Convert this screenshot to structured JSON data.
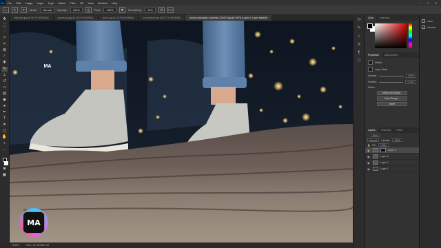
{
  "app": {
    "logo_text": "Ps"
  },
  "menu": [
    "File",
    "Edit",
    "Image",
    "Layer",
    "Type",
    "Select",
    "Filter",
    "3D",
    "View",
    "Window",
    "Help"
  ],
  "window_controls": [
    "–",
    "□",
    "✕"
  ],
  "options_bar": {
    "mode_label": "Mode:",
    "mode_value": "Normal",
    "opacity_label": "Opacity:",
    "opacity_value": "100%",
    "flow_label": "Flow:",
    "flow_value": "100%",
    "smoothing_label": "Smoothing:",
    "smoothing_value": "10%"
  },
  "tabs": [
    {
      "label": "night-sky.jpg @ 16.7% (RGB/8#)"
    },
    {
      "label": "pexels-bg.jpg @ 16.7% (RGB/8#)"
    },
    {
      "label": "stone.jpg @ 16.7% (RGB/8#)"
    },
    {
      "label": "rock-texture.jpg @ 16.7% (RGB/8#)"
    },
    {
      "label": "pexels-sebastian-voortman-214574.jpg @ 200% (Layer 4, Layer Mask/8)",
      "active": true
    }
  ],
  "status": {
    "zoom": "200%",
    "doc": "Doc: 12.1M/36.4M"
  },
  "panels": {
    "color_tabs": [
      "Color",
      "Swatches"
    ],
    "props_tabs": [
      "Properties",
      "Adjustments"
    ],
    "masks_label": "Masks",
    "layer_mask_label": "Layer Mask",
    "density_label": "Density:",
    "density_value": "100%",
    "feather_label": "Feather:",
    "feather_value": "0.0 px",
    "refine_label": "Refine:",
    "select_mask_btn": "Select and Mask...",
    "color_range_btn": "Color Range...",
    "invert_btn": "Invert",
    "layers_tabs": [
      "Layers",
      "Channels",
      "Paths"
    ],
    "kind_label": "Kind",
    "blend_mode": "Normal",
    "opacity_label": "Opacity:",
    "opacity_value": "100%",
    "fill_label": "Fill:",
    "fill_value": "100%",
    "layers": [
      {
        "name": "Layer 4",
        "selected": true
      },
      {
        "name": "Layer 3"
      },
      {
        "name": "Layer 2"
      },
      {
        "name": "Layer 1"
      }
    ]
  },
  "far_right": [
    "Learn",
    "Libraries"
  ],
  "watermark": {
    "text": "MA"
  },
  "colors": {
    "accent": "#31a8ff",
    "panel": "#323232",
    "bg": "#232323"
  }
}
